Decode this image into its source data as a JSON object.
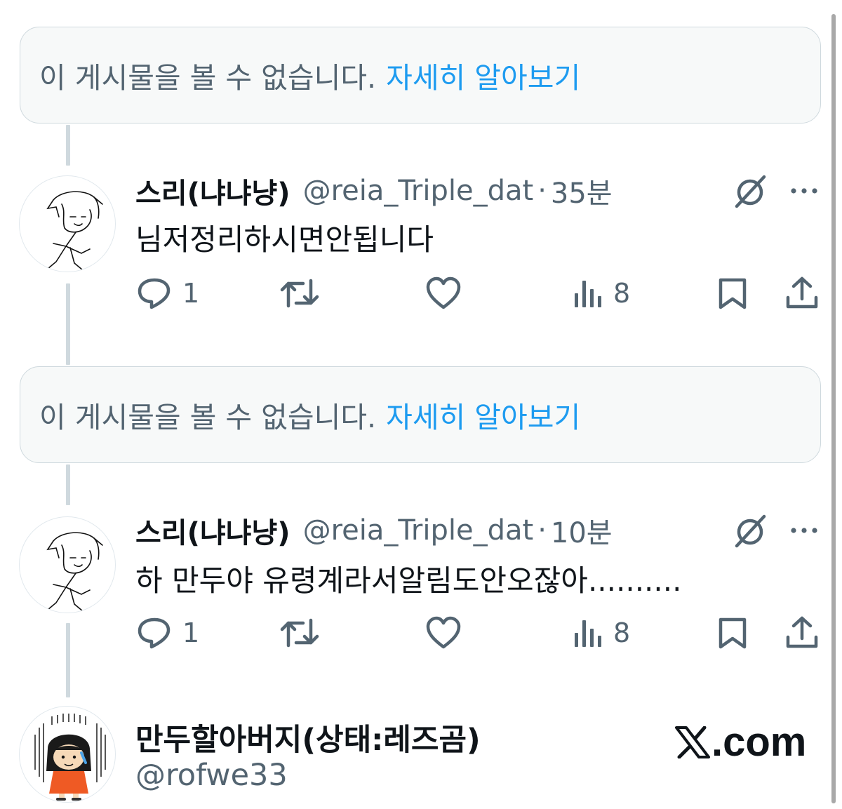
{
  "unavailable_notice": {
    "message": "이 게시물을 볼 수 없습니다.",
    "link_label": "자세히 알아보기"
  },
  "tweets": [
    {
      "display_name": "스리(냐냐냥)",
      "handle": "@reia_Triple_dat",
      "separator": "·",
      "time": "35분",
      "text": "님저정리하시면안됩니다",
      "replies": "1",
      "views": "8"
    },
    {
      "display_name": "스리(냐냐냥)",
      "handle": "@reia_Triple_dat",
      "separator": "·",
      "time": "10분",
      "text": "하 만두야 유령계라서알림도안오잖아..........",
      "replies": "1",
      "views": "8"
    }
  ],
  "profile": {
    "display_name": "만두할아버지(상태:레즈곰)",
    "handle": "@rofwe33"
  },
  "brand": {
    "mark": "𝕏",
    "rest": ".com"
  },
  "icons": {
    "reply": "speech-bubble-icon",
    "retweet": "retweet-arrows-icon",
    "like": "heart-icon",
    "views": "bar-chart-icon",
    "bookmark": "bookmark-icon",
    "share": "share-upload-icon",
    "grok": "slashed-circle-icon",
    "more": "more-dots-icon"
  },
  "colors": {
    "accent": "#1d9bf0",
    "secondary_text": "#536471",
    "primary_text": "#0f1419",
    "notice_bg": "#f7f9f9",
    "border": "#cfd9de"
  }
}
